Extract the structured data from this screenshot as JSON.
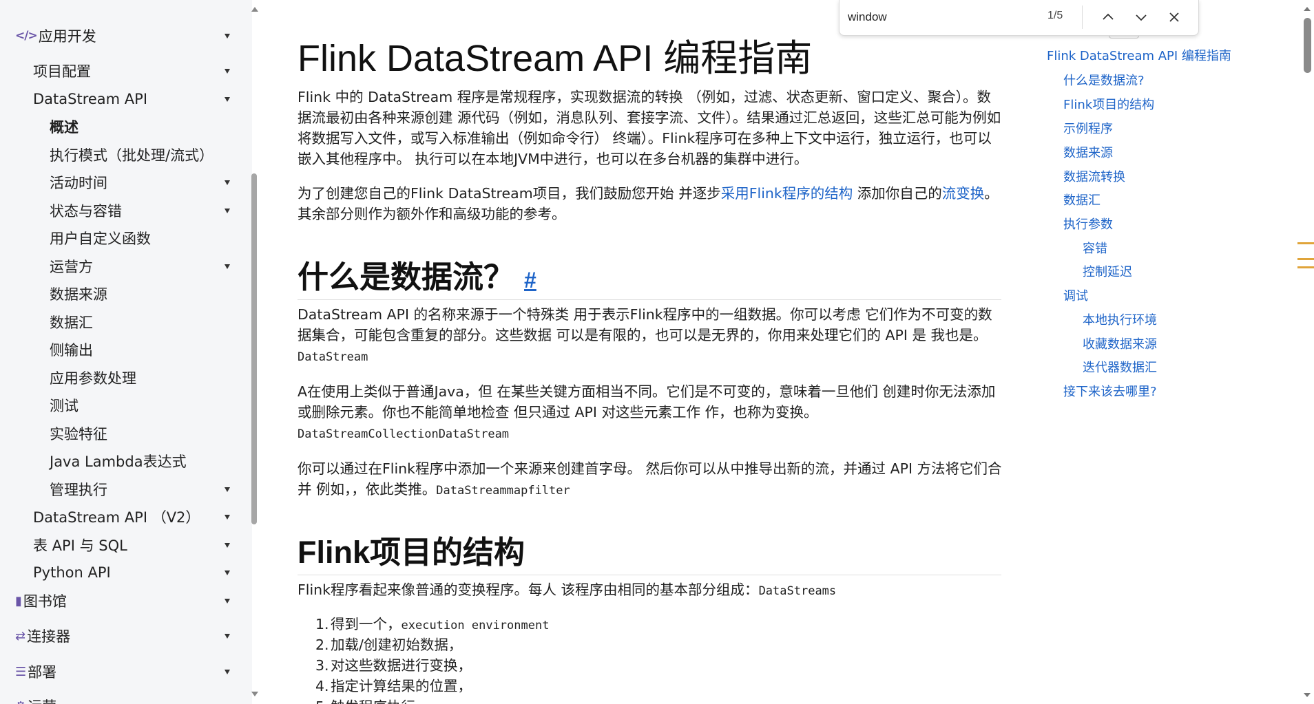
{
  "sidebar": {
    "items": [
      {
        "label": "应用开发",
        "icon": "code-icon"
      },
      {
        "label": "项目配置"
      },
      {
        "label": "DataStream API"
      },
      {
        "label": "概述"
      },
      {
        "label": "执行模式（批处理/流式）"
      },
      {
        "label": "活动时间"
      },
      {
        "label": "状态与容错"
      },
      {
        "label": "用户自定义函数"
      },
      {
        "label": "运营方"
      },
      {
        "label": "数据来源"
      },
      {
        "label": "数据汇"
      },
      {
        "label": "侧输出"
      },
      {
        "label": "应用参数处理"
      },
      {
        "label": "测试"
      },
      {
        "label": "实验特征"
      },
      {
        "label": "Java Lambda表达式"
      },
      {
        "label": "管理执行"
      },
      {
        "label": "DataStream API （V2）"
      },
      {
        "label": "表 API 与 SQL"
      },
      {
        "label": "Python API"
      },
      {
        "label": "图书馆",
        "icon": "book-icon"
      },
      {
        "label": "连接器",
        "icon": "shuffle-icon"
      },
      {
        "label": "部署",
        "icon": "sliders-icon"
      },
      {
        "label": "运营",
        "icon": "gear-icon"
      }
    ]
  },
  "main": {
    "title": "Flink DataStream API 编程指南",
    "intro": "Flink 中的 DataStream 程序是常规程序，实现数据流的转换 （例如，过滤、状态更新、窗口定义、聚合）。数据流最初由各种来源创建 源代码（例如，消息队列、套接字流、文件）。结果通过汇总返回，这些汇总可能为例如将数据写入文件，或写入标准输出（例如命令行） 终端）。Flink程序可在多种上下文中运行，独立运行，也可以嵌入其他程序中。 执行可以在本地JVM中进行，也可以在多台机器的集群中进行。",
    "p2": {
      "before": "为了创建您自己的Flink DataStream项目，我们鼓励您开始 并逐步",
      "link1": "采用Flink程序的结构",
      "middle": " 添加你自己的",
      "link2": "流变换",
      "after": "。其余部分则作为额外作和高级功能的参考。"
    },
    "h2_1": "什么是数据流？",
    "anchor": "#",
    "p3": "DataStream API 的名称来源于一个特殊类 用于表示Flink程序中的一组数据。你可以考虑 它们作为不可变的数据集合，可能包含重复的部分。这些数据 可以是有限的，也可以是无界的，你用来处理它们的 API 是 我也是。",
    "p3_code": "DataStream",
    "p4": "A在使用上类似于普通Java，但 在某些关键方面相当不同。它们是不可变的，意味着一旦他们 创建时你无法添加或删除元素。你也不能简单地检查 但只通过 API 对这些元素工作 作，也称为变换。",
    "p4_code": "DataStreamCollectionDataStream",
    "p5": "你可以通过在Flink程序中添加一个来源来创建首字母。 然后你可以从中推导出新的流，并通过 API 方法将它们合并 例如，，依此类推。",
    "p5_code": "DataStreammapfilter",
    "h2_2": "Flink项目的结构",
    "p6": "Flink程序看起来像普通的变换程序。每人 该程序由相同的基本部分组成：",
    "p6_code": "DataStreams",
    "steps": [
      {
        "num": "1.",
        "text": "得到一个，",
        "code": "execution environment"
      },
      {
        "num": "2.",
        "text": "加载/创建初始数据，",
        "code": ""
      },
      {
        "num": "3.",
        "text": "对这些数据进行变换，",
        "code": ""
      },
      {
        "num": "4.",
        "text": "指定计算结果的位置，",
        "code": ""
      },
      {
        "num": "5.",
        "text": "触发程序执行",
        "code": ""
      }
    ]
  },
  "toc": {
    "items": [
      {
        "label": "Flink DataStream API 编程指南",
        "level": 0
      },
      {
        "label": "什么是数据流?",
        "level": 1
      },
      {
        "label": "Flink项目的结构",
        "level": 1
      },
      {
        "label": "示例程序",
        "level": 1
      },
      {
        "label": "数据来源",
        "level": 1
      },
      {
        "label": "数据流转换",
        "level": 1
      },
      {
        "label": "数据汇",
        "level": 1
      },
      {
        "label": "执行参数",
        "level": 1
      },
      {
        "label": "容错",
        "level": 2
      },
      {
        "label": "控制延迟",
        "level": 2
      },
      {
        "label": "调试",
        "level": 1
      },
      {
        "label": "本地执行环境",
        "level": 2
      },
      {
        "label": "收藏数据来源",
        "level": 2
      },
      {
        "label": "迭代器数据汇",
        "level": 2
      },
      {
        "label": "接下来该去哪里?",
        "level": 1
      }
    ]
  },
  "findbar": {
    "query": "window",
    "count": "1/5"
  },
  "colors": {
    "link": "#1e64c8",
    "sidebar_bg": "#f5f6f8",
    "icon": "#6a55a8",
    "match_marker": "#e0a43a"
  }
}
